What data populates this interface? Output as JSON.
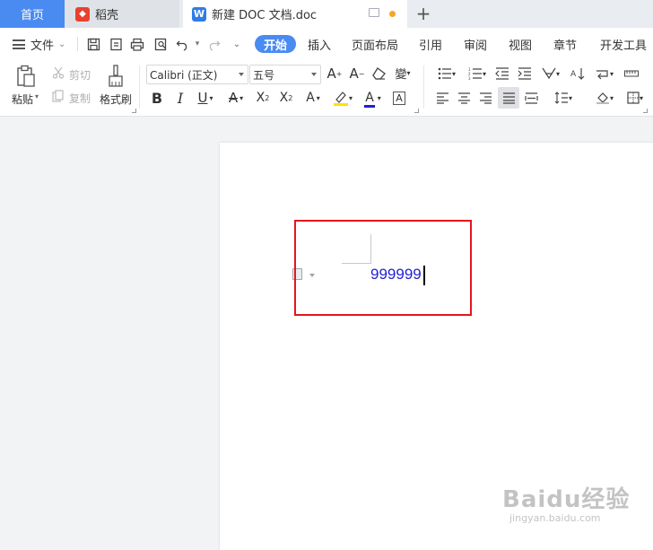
{
  "tabs": {
    "home": "首页",
    "daoke": "稻壳",
    "document": "新建 DOC 文档.doc",
    "new_tab": "+"
  },
  "menu": {
    "file": "文件",
    "tabs": [
      "开始",
      "插入",
      "页面布局",
      "引用",
      "审阅",
      "视图",
      "章节",
      "开发工具"
    ],
    "active_tab": "开始"
  },
  "ribbon": {
    "paste": "粘贴",
    "cut": "剪切",
    "copy": "复制",
    "format_painter": "格式刷",
    "font_name": "Calibri (正文)",
    "font_size": "五号"
  },
  "document": {
    "text": "999999",
    "text_color": "#1f1fd6",
    "highlight_color": "#e5141b"
  },
  "watermark": {
    "main": "Baidu经验",
    "sub": "jingyan.baidu.com"
  },
  "colors": {
    "accent": "#4a8bf2"
  }
}
